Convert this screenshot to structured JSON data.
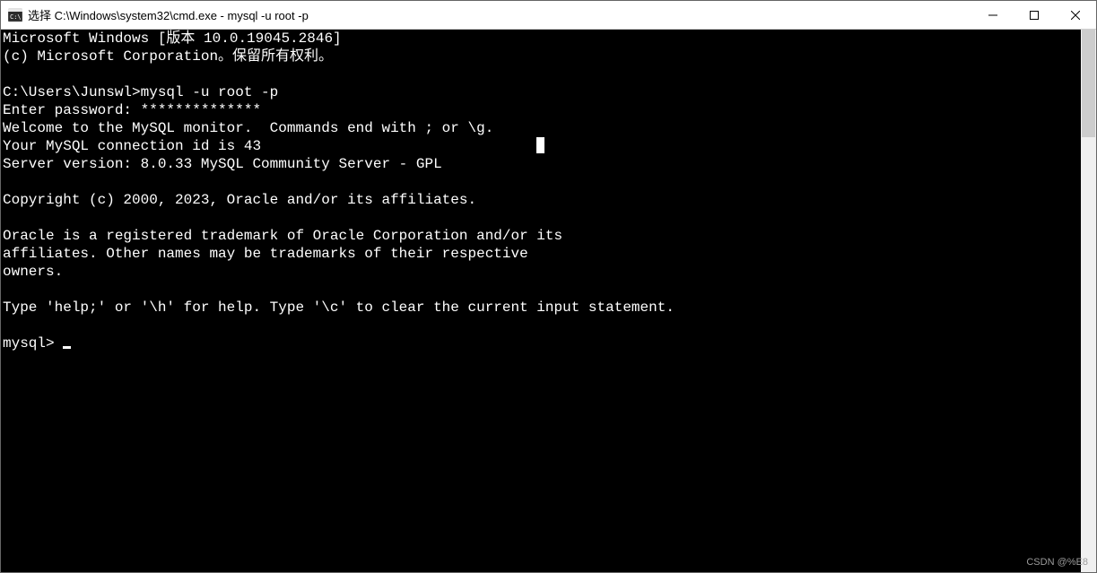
{
  "titlebar": {
    "title": "选择 C:\\Windows\\system32\\cmd.exe - mysql  -u root -p"
  },
  "console": {
    "lines": [
      "Microsoft Windows [版本 10.0.19045.2846]",
      "(c) Microsoft Corporation。保留所有权利。",
      "",
      "C:\\Users\\Junswl>mysql -u root -p",
      "Enter password: **************",
      "Welcome to the MySQL monitor.  Commands end with ; or \\g.",
      "Your MySQL connection id is 43",
      "Server version: 8.0.33 MySQL Community Server - GPL",
      "",
      "Copyright (c) 2000, 2023, Oracle and/or its affiliates.",
      "",
      "Oracle is a registered trademark of Oracle Corporation and/or its",
      "affiliates. Other names may be trademarks of their respective",
      "owners.",
      "",
      "Type 'help;' or '\\h' for help. Type '\\c' to clear the current input statement.",
      "",
      "mysql> "
    ],
    "selection_cursor_line_index": 6,
    "selection_cursor_col_chars": 62
  },
  "watermark": "CSDN @%E8"
}
